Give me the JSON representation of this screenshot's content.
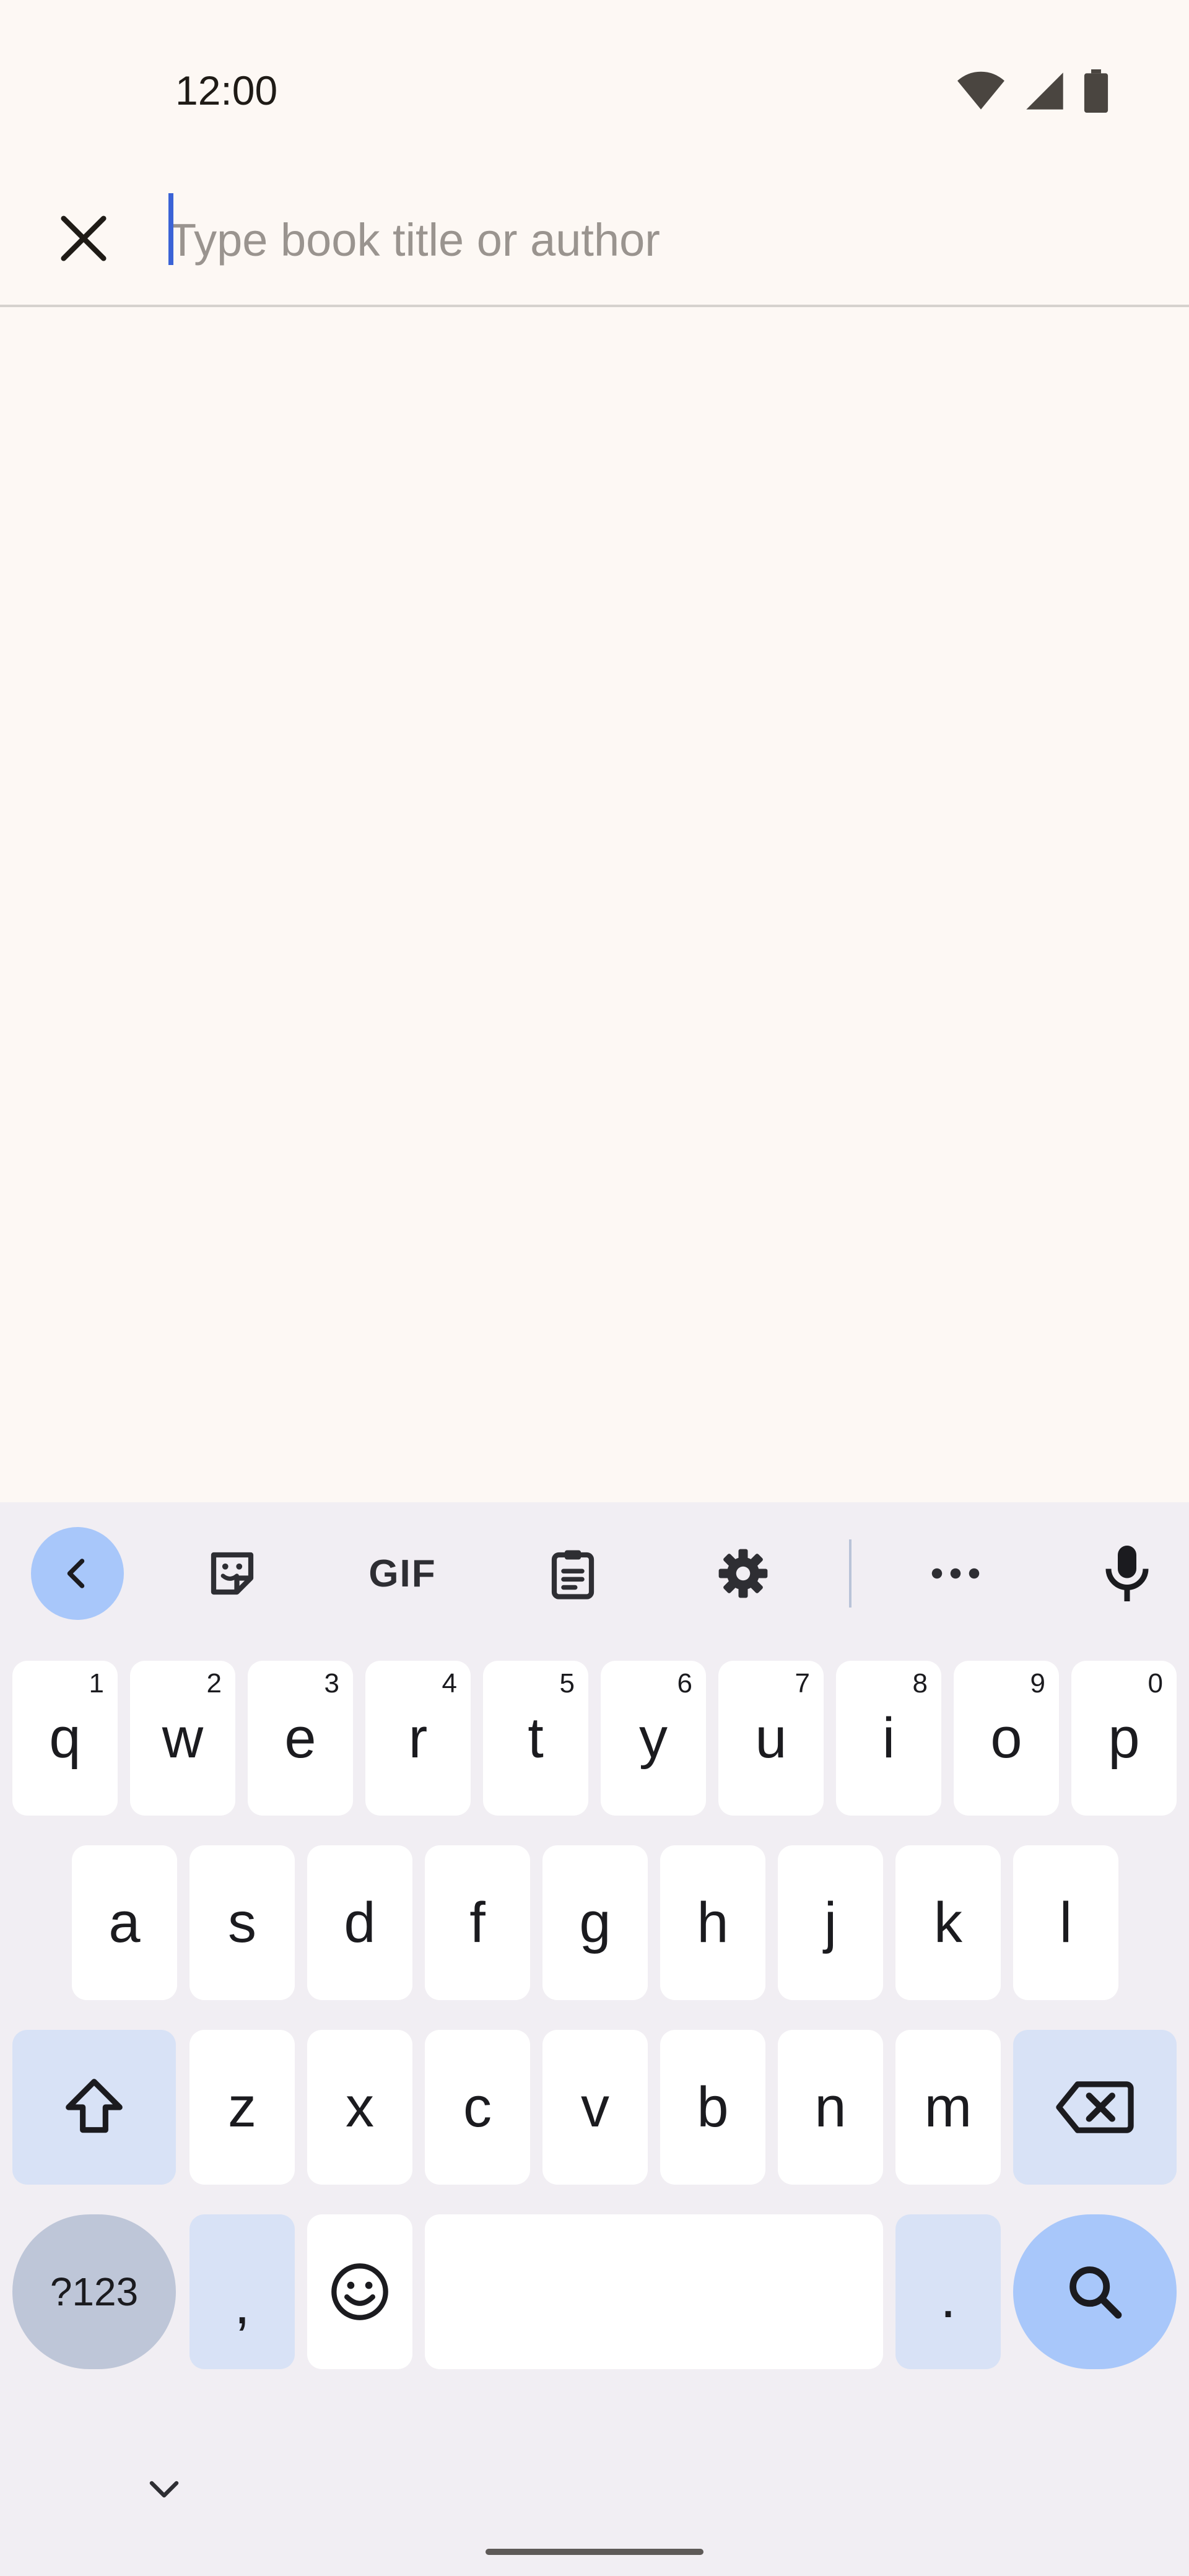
{
  "status_bar": {
    "time": "12:00",
    "icons": [
      "wifi-icon",
      "cell-signal-icon",
      "battery-icon"
    ]
  },
  "search": {
    "placeholder": "Type book title or author",
    "value": ""
  },
  "keyboard": {
    "toolbar": {
      "gif_label": "GIF",
      "icons": [
        "back-arrow-icon",
        "sticker-icon",
        "gif-icon",
        "clipboard-icon",
        "gear-icon",
        "more-icon",
        "microphone-icon"
      ]
    },
    "row1": [
      {
        "key": "q",
        "hint": "1"
      },
      {
        "key": "w",
        "hint": "2"
      },
      {
        "key": "e",
        "hint": "3"
      },
      {
        "key": "r",
        "hint": "4"
      },
      {
        "key": "t",
        "hint": "5"
      },
      {
        "key": "y",
        "hint": "6"
      },
      {
        "key": "u",
        "hint": "7"
      },
      {
        "key": "i",
        "hint": "8"
      },
      {
        "key": "o",
        "hint": "9"
      },
      {
        "key": "p",
        "hint": "0"
      }
    ],
    "row2": [
      "a",
      "s",
      "d",
      "f",
      "g",
      "h",
      "j",
      "k",
      "l"
    ],
    "row3": [
      "z",
      "x",
      "c",
      "v",
      "b",
      "n",
      "m"
    ],
    "bottom": {
      "symbols_label": "?123",
      "comma_label": ",",
      "period_label": "."
    }
  },
  "colors": {
    "accent": "#3b63d6",
    "action_key": "#a8c7fa",
    "modifier_key": "#d8e2f6",
    "background": "#fdf8f4",
    "keyboard_bg": "#f1eef3"
  }
}
